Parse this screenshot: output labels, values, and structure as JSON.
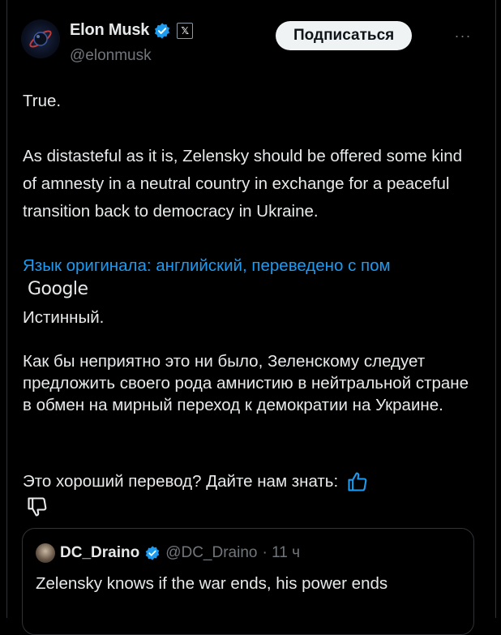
{
  "colors": {
    "background": "#000000",
    "text": "#e7e9ea",
    "muted": "#71767b",
    "link": "#1d9bf0",
    "verified": "#1d9bf0",
    "follow_button_bg": "#eff3f4"
  },
  "author": {
    "display_name": "Elon Musk",
    "handle": "@elonmusk",
    "verified_icon": "verified-badge-icon",
    "affiliate_badge": "𝕏"
  },
  "header": {
    "follow_label": "Подписаться",
    "more_label": "···"
  },
  "tweet": {
    "paragraphs": [
      "True.",
      "As distasteful as it is, Zelensky should be offered some kind of amnesty in a neutral country in exchange for a peaceful transition back to democracy in Ukraine."
    ]
  },
  "translation": {
    "note": "Язык оригинала: английский, переведено с пом",
    "provider": "Google",
    "paragraphs": [
      "Истинный.",
      "Как бы неприятно это ни было, Зеленскому следует предложить своего рода амнистию в нейтральной стране в обмен на мирный переход к демократии на Украине."
    ],
    "feedback_prompt": "Это хороший перевод? Дайте нам знать:",
    "thumbs_up_icon": "thumbs-up-icon",
    "thumbs_down_icon": "thumbs-down-icon"
  },
  "quote": {
    "display_name": "DC_Draino",
    "handle": "@DC_Draino",
    "time": "· 11 ч",
    "text": "Zelensky knows if the war ends, his power ends"
  }
}
